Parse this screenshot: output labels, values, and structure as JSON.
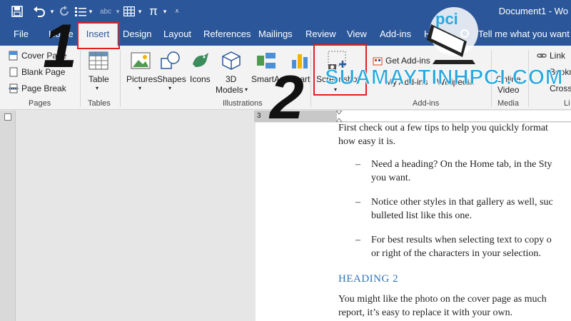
{
  "window": {
    "title": "Document1 - Wo"
  },
  "quick_access": {
    "save_icon": "save-icon",
    "undo_icon": "undo-icon",
    "redo_icon": "redo-icon",
    "pi_symbol": "π"
  },
  "tabs": [
    {
      "label": "File"
    },
    {
      "label": "Home"
    },
    {
      "label": "Insert",
      "active": true
    },
    {
      "label": "Design"
    },
    {
      "label": "Layout"
    },
    {
      "label": "References"
    },
    {
      "label": "Mailings"
    },
    {
      "label": "Review"
    },
    {
      "label": "View"
    },
    {
      "label": "Add-ins"
    },
    {
      "label": "Help"
    }
  ],
  "tell_me": "Tell me what you want to",
  "ribbon": {
    "pages": {
      "items": [
        "Cover Page",
        "Blank Page",
        "Page Break"
      ],
      "label": "Pages"
    },
    "tables": {
      "button": "Table",
      "label": "Tables"
    },
    "illustrations": {
      "buttons": [
        "Pictures",
        "Shapes",
        "Icons",
        "3D",
        "Models",
        "SmartArt",
        "Chart"
      ],
      "label": "Illustrations"
    },
    "screenshot": {
      "label": "Screenshot"
    },
    "addins": {
      "get": "Get Add-ins",
      "my": "My Add-ins",
      "wiki": "Wikipedia",
      "label": "Add-ins"
    },
    "media": {
      "online": "Online",
      "video": "Video",
      "label": "Media"
    },
    "links": {
      "items": [
        "Link",
        "Bookm",
        "Cross-"
      ],
      "label": "Li"
    }
  },
  "ruler": {
    "left_number": "3"
  },
  "document": {
    "para1_line1": "First check out a few tips to help you quickly format",
    "para1_line2": "how easy it is.",
    "bullets": [
      {
        "line1": "Need a heading? On the Home tab, in the Sty",
        "line2": "you want."
      },
      {
        "line1": "Notice other styles in that gallery as well, suc",
        "line2": "bulleted list like this one."
      },
      {
        "line1": "For best results when selecting text to copy o",
        "line2": "or right of the characters in your selection."
      }
    ],
    "heading2": "HEADING 2",
    "para2_line1": "You might like the photo on the cover page as much",
    "para2_line2": "report, it’s easy to replace it with your own."
  },
  "annotations": {
    "step1": "1",
    "step2": "2",
    "highlight_color": "#e02020"
  },
  "watermark": {
    "text": "SUAMAYTINHPCI.COM",
    "logo_text": "pci"
  },
  "colors": {
    "word_blue": "#2b579a",
    "ribbon_bg": "#f3f3f3",
    "heading_blue": "#2e74b5"
  }
}
